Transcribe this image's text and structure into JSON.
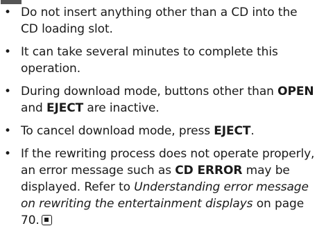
{
  "notes": [
    {
      "text": "Do not insert anything other than a CD into the CD loading slot."
    },
    {
      "text": "It can take several minutes to complete this operation."
    },
    {
      "before": "During download mode, buttons other than ",
      "bold1": "OPEN",
      "mid": " and ",
      "bold2": "EJECT",
      "after": " are inactive."
    },
    {
      "before": "To cancel download mode, press ",
      "bold": "EJECT",
      "after": "."
    },
    {
      "before": "If the rewriting process does not operate properly, an error message such as ",
      "bold": "CD ERROR",
      "mid": " may be displayed. Refer to ",
      "italic": "Understanding error message on rewriting the entertainment displays",
      "after": " on page 70."
    }
  ],
  "bullet_char": "•",
  "end_icon": "end-of-section-icon"
}
